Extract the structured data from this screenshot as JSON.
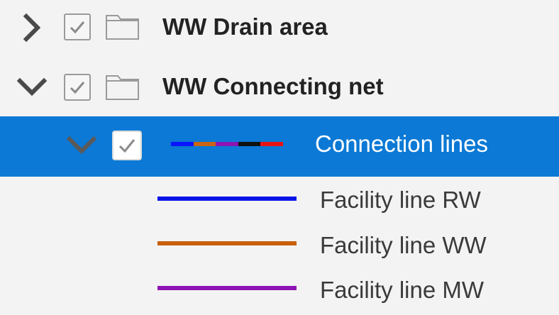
{
  "tree": {
    "drain_area": {
      "label": "WW Drain area",
      "expanded": false,
      "checked": true,
      "icon": "folder-icon"
    },
    "connecting_net": {
      "label": "WW Connecting net",
      "expanded": true,
      "checked": true,
      "icon": "folder-icon"
    },
    "connection_lines": {
      "label": "Connection lines",
      "expanded": true,
      "checked": true,
      "selected": true,
      "highlight_color": "#0b79d5",
      "symbol_colors": [
        "#0a14ff",
        "#c86414",
        "#8c14b4",
        "#111111",
        "#e81414"
      ]
    },
    "legend": [
      {
        "label": "Facility line RW",
        "color": "#0a14e8"
      },
      {
        "label": "Facility line WW",
        "color": "#c8600a"
      },
      {
        "label": "Facility line MW",
        "color": "#8c14b4"
      }
    ]
  }
}
